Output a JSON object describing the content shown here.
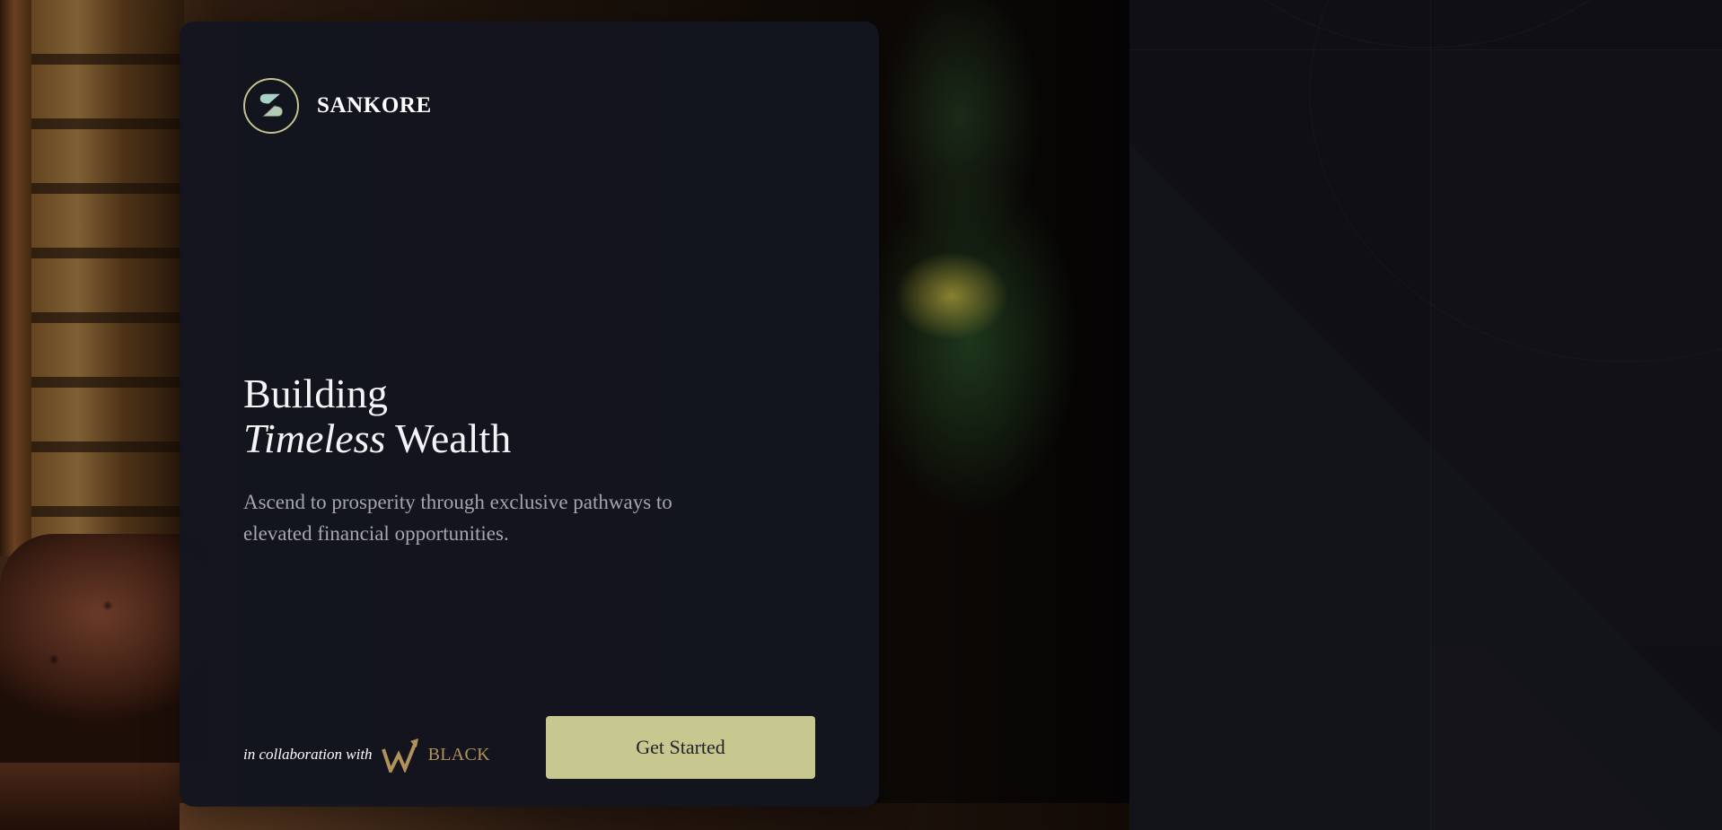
{
  "brand": {
    "name": "SANKORE",
    "logo_icon": "sankore-s-logo-icon"
  },
  "hero": {
    "headline_line1": "Building",
    "headline_italic": "Timeless",
    "headline_rest": "Wealth",
    "subtitle": "Ascend to prosperity through exclusive pathways to elevated financial opportunities."
  },
  "footer": {
    "collab_text": "in collaboration with",
    "partner_icon": "w-arrow-logo-icon",
    "partner_name": "BLACK"
  },
  "cta": {
    "label": "Get Started"
  },
  "colors": {
    "accent": "#c7c88f",
    "card_bg": "#13151f",
    "partner_gold": "#b0925a",
    "logo_teal": "#a7d3c7"
  }
}
